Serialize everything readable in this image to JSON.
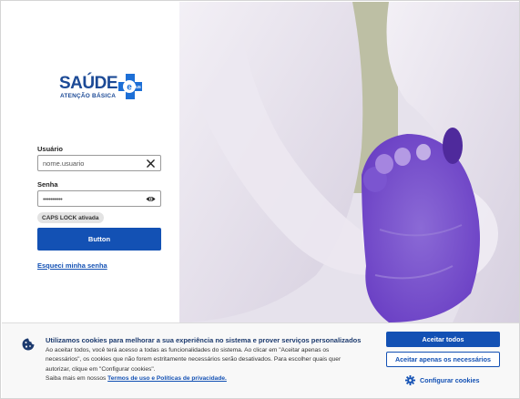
{
  "logo": {
    "word": "SAÚDE",
    "cross_text": "e sus",
    "subtitle": "ATENÇÃO BÁSICA"
  },
  "login": {
    "username_label": "Usuário",
    "username_value": "nome.usuario",
    "password_label": "Senha",
    "password_value": "••••••••••",
    "caps_lock": "CAPS LOCK ativada",
    "submit_label": "Button",
    "forgot_label": "Esqueci minha senha",
    "clear_icon": "close-icon",
    "reveal_icon": "eye-icon"
  },
  "cookie": {
    "title": "Utilizamos cookies para melhorar a sua experiência no sistema e prover serviços personalizados",
    "body": "Ao aceitar todos, você terá acesso a todas as funcionalidades do sistema. Ao clicar em \"Aceitar apenas os necessários\", os cookies que não forem estritamente necessários serão desativados. Para escolher quais quer autorizar, clique em \"Configurar cookies\".",
    "more_prefix": "Saiba mais em nossos ",
    "terms_link": "Termos de uso e Políticas de privacidade.",
    "accept_all": "Aceitar todos",
    "accept_necessary": "Aceitar apenas os necessários",
    "configure": "Configurar cookies"
  },
  "colors": {
    "primary": "#1351b4",
    "logo_blue": "#1c4a96",
    "cross_blue": "#1d6fd6"
  }
}
